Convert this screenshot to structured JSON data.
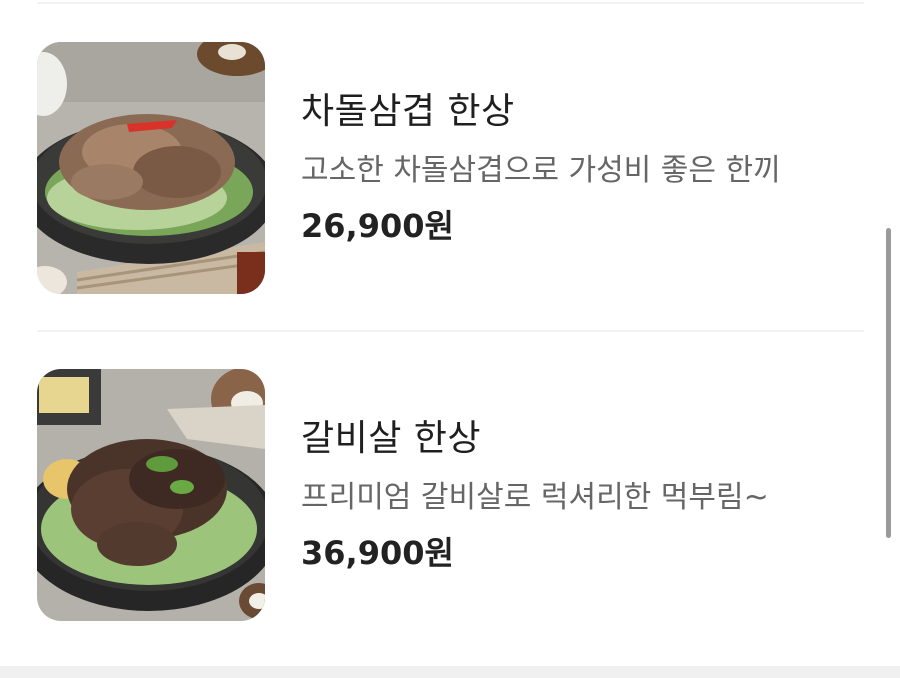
{
  "menu": {
    "items": [
      {
        "name": "차돌삼겹 한상",
        "description": "고소한 차돌삼겹으로 가성비 좋은 한끼",
        "price": "26,900원",
        "image_icon": "chadol-samgyeop-dish-photo"
      },
      {
        "name": "갈비살 한상",
        "description": "프리미엄 갈비살로 럭셔리한 먹부림~",
        "price": "36,900원",
        "image_icon": "galbisal-dish-photo"
      }
    ]
  },
  "colors": {
    "title": "#1f1f1f",
    "description": "#666666",
    "price": "#222222",
    "divider": "#f1f1f1",
    "scrollbar": "#9a9a9a"
  }
}
